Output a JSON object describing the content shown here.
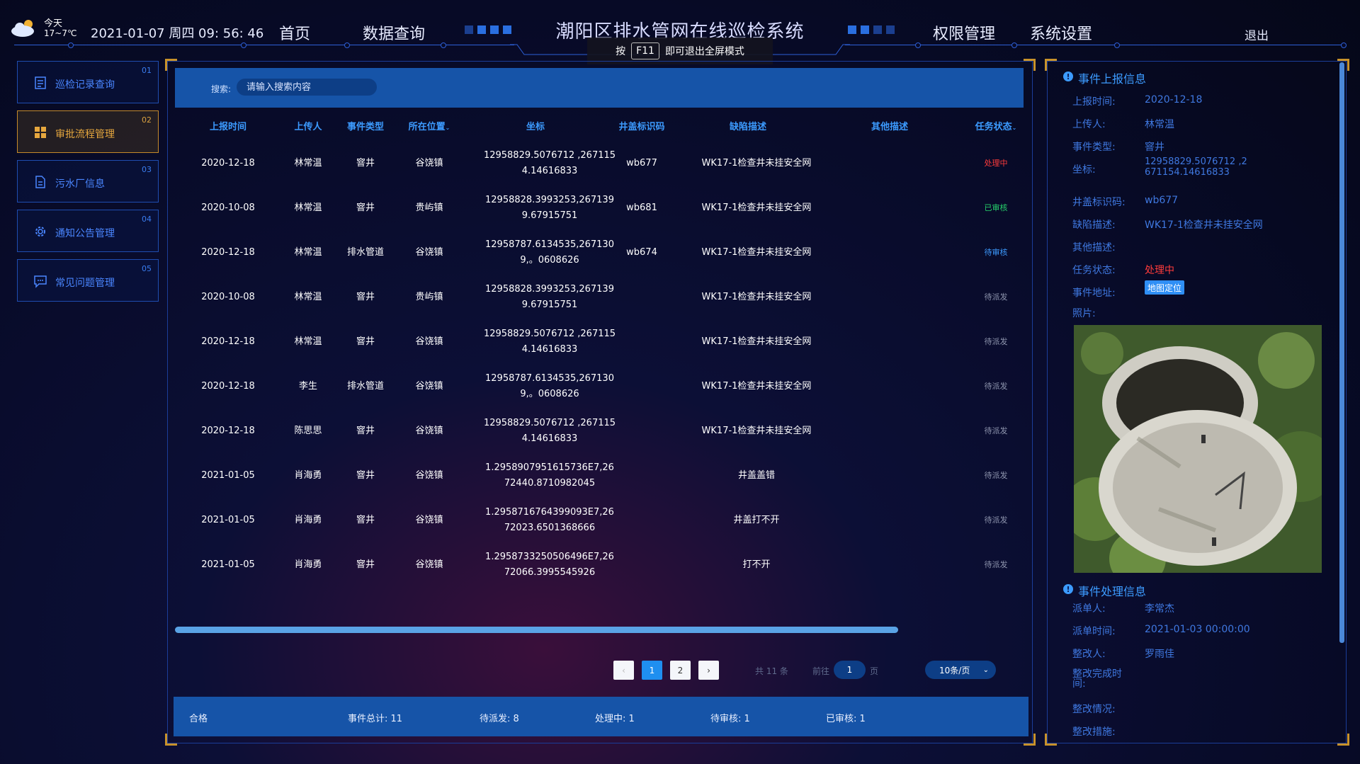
{
  "header": {
    "weather": {
      "today": "今天",
      "temp": "17~7℃"
    },
    "datetime": "2021-01-07 周四 09: 56: 46",
    "nav_left": [
      "首页",
      "数据查询"
    ],
    "title": "潮阳区排水管网在线巡检系统",
    "nav_right": [
      "权限管理",
      "系统设置"
    ],
    "logout": "退出",
    "toast": {
      "prefix": "按",
      "key": "F11",
      "suffix": "即可退出全屏模式"
    }
  },
  "sidebar": {
    "items": [
      {
        "num": "01",
        "label": "巡检记录查询",
        "icon": "document-list-icon",
        "active": false
      },
      {
        "num": "02",
        "label": "审批流程管理",
        "icon": "grid-icon",
        "active": true
      },
      {
        "num": "03",
        "label": "污水厂信息",
        "icon": "file-icon",
        "active": false
      },
      {
        "num": "04",
        "label": "通知公告管理",
        "icon": "gear-icon",
        "active": false
      },
      {
        "num": "05",
        "label": "常见问题管理",
        "icon": "chat-icon",
        "active": false
      }
    ]
  },
  "search": {
    "label": "搜索:",
    "placeholder": "请输入搜索内容"
  },
  "table": {
    "headers": [
      "上报时间",
      "上传人",
      "事件类型",
      "所在位置",
      "坐标",
      "井盖标识码",
      "缺陷描述",
      "其他描述",
      "任务状态"
    ],
    "rows": [
      {
        "time": "2020-12-18",
        "user": "林常温",
        "type": "窨井",
        "loc": "谷饶镇",
        "coord1": "12958829.5076712 ,267115",
        "coord2": "4.14616833",
        "code": "wb677",
        "defect": "WK17-1检查井未挂安全网",
        "other": "",
        "status": "处理中",
        "status_color": "red"
      },
      {
        "time": "2020-10-08",
        "user": "林常温",
        "type": "窨井",
        "loc": "贵屿镇",
        "coord1": "12958828.3993253,267139",
        "coord2": "9.67915751",
        "code": "wb681",
        "defect": "WK17-1检查井未挂安全网",
        "other": "",
        "status": "已审核",
        "status_color": "green"
      },
      {
        "time": "2020-12-18",
        "user": "林常温",
        "type": "排水管道",
        "loc": "谷饶镇",
        "coord1": "12958787.6134535,267130",
        "coord2": "9,。0608626",
        "code": "wb674",
        "defect": "WK17-1检查井未挂安全网",
        "other": "",
        "status": "待审核",
        "status_color": "blue"
      },
      {
        "time": "2020-10-08",
        "user": "林常温",
        "type": "窨井",
        "loc": "贵屿镇",
        "coord1": "12958828.3993253,267139",
        "coord2": "9.67915751",
        "code": "",
        "defect": "WK17-1检查井未挂安全网",
        "other": "",
        "status": "待派发",
        "status_color": "grey"
      },
      {
        "time": "2020-12-18",
        "user": "林常温",
        "type": "窨井",
        "loc": "谷饶镇",
        "coord1": "12958829.5076712 ,267115",
        "coord2": "4.14616833",
        "code": "",
        "defect": "WK17-1检查井未挂安全网",
        "other": "",
        "status": "待派发",
        "status_color": "grey"
      },
      {
        "time": "2020-12-18",
        "user": "李生",
        "type": "排水管道",
        "loc": "谷饶镇",
        "coord1": "12958787.6134535,267130",
        "coord2": "9,。0608626",
        "code": "",
        "defect": "WK17-1检查井未挂安全网",
        "other": "",
        "status": "待派发",
        "status_color": "grey"
      },
      {
        "time": "2020-12-18",
        "user": "陈思思",
        "type": "窨井",
        "loc": "谷饶镇",
        "coord1": "12958829.5076712 ,267115",
        "coord2": "4.14616833",
        "code": "",
        "defect": "WK17-1检查井未挂安全网",
        "other": "",
        "status": "待派发",
        "status_color": "grey"
      },
      {
        "time": "2021-01-05",
        "user": "肖海勇",
        "type": "窨井",
        "loc": "谷饶镇",
        "coord1": "1.2958907951615736E7,26",
        "coord2": "72440.8710982045",
        "code": "",
        "defect": "井盖盖错",
        "other": "",
        "status": "待派发",
        "status_color": "grey"
      },
      {
        "time": "2021-01-05",
        "user": "肖海勇",
        "type": "窨井",
        "loc": "谷饶镇",
        "coord1": "1.2958716764399093E7,26",
        "coord2": "72023.6501368666",
        "code": "",
        "defect": "井盖打不开",
        "other": "",
        "status": "待派发",
        "status_color": "grey"
      },
      {
        "time": "2021-01-05",
        "user": "肖海勇",
        "type": "窨井",
        "loc": "谷饶镇",
        "coord1": "1.2958733250506496E7,26",
        "coord2": "72066.3995545926",
        "code": "",
        "defect": "打不开",
        "other": "",
        "status": "待派发",
        "status_color": "grey"
      }
    ]
  },
  "pagination": {
    "prev": "‹",
    "pages": [
      "1",
      "2"
    ],
    "next": "›",
    "total": "共 11 条",
    "goto_prefix": "前往",
    "goto_value": "1",
    "goto_suffix": "页",
    "page_size": "10条/页"
  },
  "footer": {
    "status": "合格",
    "total": "事件总计: 11",
    "pending_dispatch": "待派发: 8",
    "processing": "处理中: 1",
    "pending_review": "待审核: 1",
    "reviewed": "已审核: 1"
  },
  "detail": {
    "report_title": "事件上报信息",
    "report": [
      {
        "k": "上报时间:",
        "v": "2020-12-18"
      },
      {
        "k": "上传人:",
        "v": "林常温"
      },
      {
        "k": "事件类型:",
        "v": "窨井"
      },
      {
        "k": "坐标:",
        "v": "12958829.5076712 ,2671154.14616833"
      },
      {
        "k": "井盖标识码:",
        "v": "wb677"
      },
      {
        "k": "缺陷描述:",
        "v": "WK17-1检查井未挂安全网"
      },
      {
        "k": "其他描述:",
        "v": ""
      },
      {
        "k": "任务状态:",
        "v": "处理中"
      },
      {
        "k": "事件地址:",
        "v": ""
      }
    ],
    "map_button": "地图定位",
    "photo_label": "照片:",
    "process_title": "事件处理信息",
    "process": [
      {
        "k": "派单人:",
        "v": "李常杰"
      },
      {
        "k": "派单时间:",
        "v": "2021-01-03 00:00:00"
      },
      {
        "k": "整改人:",
        "v": "罗雨佳"
      },
      {
        "k": "整改完成时间:",
        "v": ""
      },
      {
        "k": "整改情况:",
        "v": ""
      },
      {
        "k": "整改措施:",
        "v": ""
      }
    ]
  },
  "colors": {
    "accent": "#1f8ff0",
    "active_gold": "#e6a73e",
    "status_red": "#ff3b3b",
    "status_green": "#26d26b"
  }
}
